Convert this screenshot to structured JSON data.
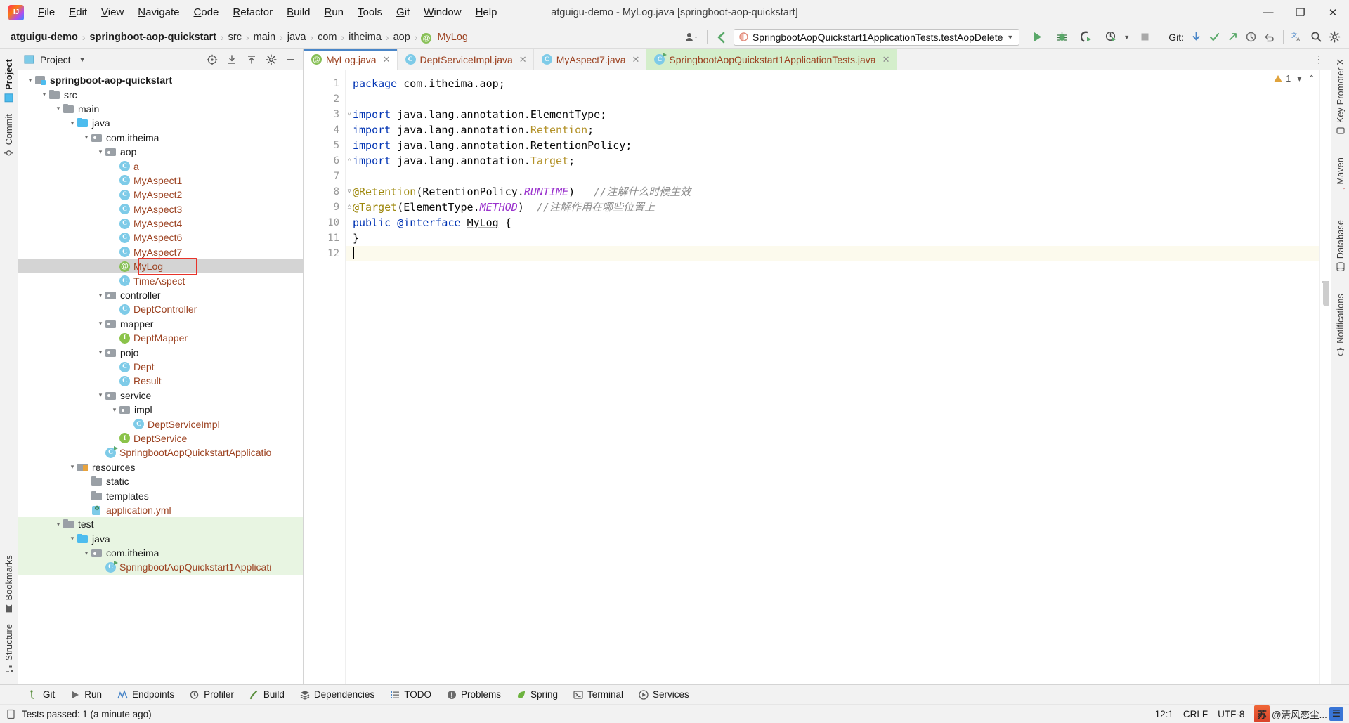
{
  "window": {
    "title": "atguigu-demo - MyLog.java [springboot-aop-quickstart]",
    "minimize": "—",
    "maximize": "❐",
    "close": "✕"
  },
  "menu": [
    {
      "label": "File"
    },
    {
      "label": "Edit"
    },
    {
      "label": "View"
    },
    {
      "label": "Navigate"
    },
    {
      "label": "Code"
    },
    {
      "label": "Refactor"
    },
    {
      "label": "Build"
    },
    {
      "label": "Run"
    },
    {
      "label": "Tools"
    },
    {
      "label": "Git"
    },
    {
      "label": "Window"
    },
    {
      "label": "Help"
    }
  ],
  "breadcrumb": {
    "items": [
      {
        "label": "atguigu-demo",
        "style": "bold"
      },
      {
        "label": "springboot-aop-quickstart",
        "style": "bold"
      },
      {
        "label": "src",
        "style": "dim"
      },
      {
        "label": "main",
        "style": "dim"
      },
      {
        "label": "java",
        "style": "dim"
      },
      {
        "label": "com",
        "style": "dim"
      },
      {
        "label": "itheima",
        "style": "dim"
      },
      {
        "label": "aop",
        "style": "dim"
      },
      {
        "label": "MyLog",
        "style": "file"
      }
    ],
    "separator": "›"
  },
  "toolbar": {
    "profile_icon": "user-profile-icon",
    "back_icon": "navigate-back-icon",
    "run_config": "SpringbootAopQuickstart1ApplicationTests.testAopDelete",
    "run_config_caret": "▼",
    "run_label": "run-button",
    "debug_label": "debug-button",
    "coverage_label": "run-with-coverage-button",
    "profile_label": "profiler-button",
    "stop_label": "stop-button",
    "git_label": "Git:",
    "git_update": "update-project-icon",
    "git_commit": "commit-icon",
    "git_push": "push-icon",
    "history_icon": "history-icon",
    "undo_icon": "undo-icon",
    "translate_icon": "translate-icon",
    "search_icon": "search-everywhere-icon",
    "settings_icon": "settings-icon",
    "more_icon": "more-options-icon"
  },
  "left_strip": [
    {
      "label": "Project",
      "active": true,
      "name": "tool-window-project"
    },
    {
      "label": "Commit",
      "active": false,
      "name": "tool-window-commit"
    },
    {
      "label": "Bookmarks",
      "active": false,
      "name": "tool-window-bookmarks"
    },
    {
      "label": "Structure",
      "active": false,
      "name": "tool-window-structure"
    }
  ],
  "right_strip": [
    {
      "label": "Key Promoter X",
      "name": "tool-window-key-promoter-x"
    },
    {
      "label": "Maven",
      "name": "tool-window-maven"
    },
    {
      "label": "Database",
      "name": "tool-window-database"
    },
    {
      "label": "Notifications",
      "name": "tool-window-notifications"
    }
  ],
  "project_panel": {
    "title": "Project",
    "title_caret": "▼",
    "actions": [
      {
        "name": "select-opened-file-icon"
      },
      {
        "name": "expand-all-icon"
      },
      {
        "name": "collapse-all-icon"
      },
      {
        "name": "settings-icon"
      },
      {
        "name": "hide-icon"
      }
    ],
    "tree": [
      {
        "label": "springboot-aop-quickstart",
        "depth": 1,
        "icon": "module",
        "chev": "down",
        "style": "bold"
      },
      {
        "label": "src",
        "depth": 2,
        "icon": "folder",
        "chev": "down"
      },
      {
        "label": "main",
        "depth": 3,
        "icon": "folder",
        "chev": "down"
      },
      {
        "label": "java",
        "depth": 4,
        "icon": "folder-blue",
        "chev": "down"
      },
      {
        "label": "com.itheima",
        "depth": 5,
        "icon": "package",
        "chev": "down"
      },
      {
        "label": "aop",
        "depth": 6,
        "icon": "package",
        "chev": "down"
      },
      {
        "label": "a",
        "depth": 7,
        "icon": "class",
        "chev": "none",
        "style": "cls"
      },
      {
        "label": "MyAspect1",
        "depth": 7,
        "icon": "class",
        "chev": "none",
        "style": "cls"
      },
      {
        "label": "MyAspect2",
        "depth": 7,
        "icon": "class",
        "chev": "none",
        "style": "cls"
      },
      {
        "label": "MyAspect3",
        "depth": 7,
        "icon": "class",
        "chev": "none",
        "style": "cls"
      },
      {
        "label": "MyAspect4",
        "depth": 7,
        "icon": "class",
        "chev": "none",
        "style": "cls"
      },
      {
        "label": "MyAspect6",
        "depth": 7,
        "icon": "class",
        "chev": "none",
        "style": "cls"
      },
      {
        "label": "MyAspect7",
        "depth": 7,
        "icon": "class",
        "chev": "none",
        "style": "cls"
      },
      {
        "label": "MyLog",
        "depth": 7,
        "icon": "annotation",
        "chev": "none",
        "style": "cls",
        "selected": true,
        "highlight_box": true
      },
      {
        "label": "TimeAspect",
        "depth": 7,
        "icon": "class",
        "chev": "none",
        "style": "cls"
      },
      {
        "label": "controller",
        "depth": 6,
        "icon": "package",
        "chev": "down"
      },
      {
        "label": "DeptController",
        "depth": 7,
        "icon": "class",
        "chev": "none",
        "style": "cls"
      },
      {
        "label": "mapper",
        "depth": 6,
        "icon": "package",
        "chev": "down"
      },
      {
        "label": "DeptMapper",
        "depth": 7,
        "icon": "interface",
        "chev": "none",
        "style": "cls"
      },
      {
        "label": "pojo",
        "depth": 6,
        "icon": "package",
        "chev": "down"
      },
      {
        "label": "Dept",
        "depth": 7,
        "icon": "class",
        "chev": "none",
        "style": "cls"
      },
      {
        "label": "Result",
        "depth": 7,
        "icon": "class",
        "chev": "none",
        "style": "cls"
      },
      {
        "label": "service",
        "depth": 6,
        "icon": "package",
        "chev": "down"
      },
      {
        "label": "impl",
        "depth": 7,
        "icon": "package",
        "chev": "down"
      },
      {
        "label": "DeptServiceImpl",
        "depth": 8,
        "icon": "class",
        "chev": "none",
        "style": "cls"
      },
      {
        "label": "DeptService",
        "depth": 7,
        "icon": "interface",
        "chev": "none",
        "style": "cls"
      },
      {
        "label": "SpringbootAopQuickstartApplicatio",
        "depth": 6,
        "icon": "runnable-class",
        "chev": "none",
        "style": "cls"
      },
      {
        "label": "resources",
        "depth": 4,
        "icon": "resources",
        "chev": "down"
      },
      {
        "label": "static",
        "depth": 5,
        "icon": "folder",
        "chev": "none"
      },
      {
        "label": "templates",
        "depth": 5,
        "icon": "folder",
        "chev": "none"
      },
      {
        "label": "application.yml",
        "depth": 5,
        "icon": "yml",
        "chev": "none",
        "style": "yml"
      },
      {
        "label": "test",
        "depth": 3,
        "icon": "folder",
        "chev": "down",
        "testbg": true
      },
      {
        "label": "java",
        "depth": 4,
        "icon": "folder-blue",
        "chev": "down",
        "testbg": true
      },
      {
        "label": "com.itheima",
        "depth": 5,
        "icon": "package",
        "chev": "down",
        "testbg": true
      },
      {
        "label": "SpringbootAopQuickstart1Applicati",
        "depth": 6,
        "icon": "runnable-class",
        "chev": "none",
        "style": "cls",
        "testbg": true
      }
    ]
  },
  "editor": {
    "tabs": [
      {
        "label": "MyLog.java",
        "icon": "annotation",
        "active": true,
        "close": "✕"
      },
      {
        "label": "DeptServiceImpl.java",
        "icon": "class",
        "active": false,
        "close": "✕"
      },
      {
        "label": "MyAspect7.java",
        "icon": "class",
        "active": false,
        "close": "✕"
      },
      {
        "label": "SpringbootAopQuickstart1ApplicationTests.java",
        "icon": "runnable-class",
        "active": false,
        "close": "✕",
        "highlight": true
      }
    ],
    "line_numbers": [
      "1",
      "2",
      "3",
      "4",
      "5",
      "6",
      "7",
      "8",
      "9",
      "10",
      "11",
      "12"
    ],
    "lines": [
      {
        "n": 1,
        "tokens": [
          {
            "t": "package ",
            "c": "kw"
          },
          {
            "t": "com.itheima.aop;",
            "c": "pkgtxt"
          }
        ]
      },
      {
        "n": 2,
        "tokens": []
      },
      {
        "n": 3,
        "fold": "collapse-start",
        "tokens": [
          {
            "t": "import ",
            "c": "kw"
          },
          {
            "t": "java.lang.annotation.ElementType;",
            "c": "pkgtxt"
          }
        ]
      },
      {
        "n": 4,
        "tokens": [
          {
            "t": "import ",
            "c": "kw"
          },
          {
            "t": "java.lang.annotation.",
            "c": "pkgtxt"
          },
          {
            "t": "Retention",
            "c": "type"
          },
          {
            "t": ";",
            "c": "pkgtxt"
          }
        ]
      },
      {
        "n": 5,
        "tokens": [
          {
            "t": "import ",
            "c": "kw"
          },
          {
            "t": "java.lang.annotation.RetentionPolicy;",
            "c": "pkgtxt"
          }
        ]
      },
      {
        "n": 6,
        "fold": "collapse-end",
        "tokens": [
          {
            "t": "import ",
            "c": "kw"
          },
          {
            "t": "java.lang.annotation.",
            "c": "pkgtxt"
          },
          {
            "t": "Target",
            "c": "type"
          },
          {
            "t": ";",
            "c": "pkgtxt"
          }
        ]
      },
      {
        "n": 7,
        "tokens": []
      },
      {
        "n": 8,
        "fold": "collapse-start",
        "tokens": [
          {
            "t": "@Retention",
            "c": "anno"
          },
          {
            "t": "(RetentionPolicy.",
            "c": "ident"
          },
          {
            "t": "RUNTIME",
            "c": "const"
          },
          {
            "t": ")",
            "c": "ident"
          },
          {
            "t": "   //注解什么时候生效",
            "c": "cmt"
          }
        ]
      },
      {
        "n": 9,
        "fold": "collapse-end",
        "tokens": [
          {
            "t": "@Target",
            "c": "anno"
          },
          {
            "t": "(ElementType.",
            "c": "ident"
          },
          {
            "t": "METHOD",
            "c": "const"
          },
          {
            "t": ")",
            "c": "ident"
          },
          {
            "t": "  //注解作用在哪些位置上",
            "c": "cmt"
          }
        ]
      },
      {
        "n": 10,
        "tokens": [
          {
            "t": "public ",
            "c": "kw"
          },
          {
            "t": "@interface ",
            "c": "kw"
          },
          {
            "t": "MyLog",
            "c": "annoname"
          },
          {
            "t": " {",
            "c": "ident"
          }
        ]
      },
      {
        "n": 11,
        "tokens": [
          {
            "t": "}",
            "c": "ident"
          }
        ]
      },
      {
        "n": 12,
        "cursor": true,
        "tokens": []
      }
    ],
    "inspection_count": "1",
    "inspection_caret": "▾",
    "inspection_collapse": "⌃"
  },
  "bottom_tools": [
    {
      "label": "Git",
      "icon": "git-branch-icon"
    },
    {
      "label": "Run",
      "icon": "run-icon"
    },
    {
      "label": "Endpoints",
      "icon": "endpoints-icon"
    },
    {
      "label": "Profiler",
      "icon": "profiler-icon"
    },
    {
      "label": "Build",
      "icon": "build-hammer-icon"
    },
    {
      "label": "Dependencies",
      "icon": "dependencies-icon"
    },
    {
      "label": "TODO",
      "icon": "todo-list-icon"
    },
    {
      "label": "Problems",
      "icon": "problems-icon"
    },
    {
      "label": "Spring",
      "icon": "spring-leaf-icon"
    },
    {
      "label": "Terminal",
      "icon": "terminal-icon"
    },
    {
      "label": "Services",
      "icon": "services-icon"
    }
  ],
  "status_bar": {
    "message": "Tests passed: 1 (a minute ago)",
    "message_icon": "tests-status-icon",
    "position": "12:1",
    "line_sep": "CRLF",
    "encoding": "UTF-8",
    "watermark_badge": "苏",
    "watermark_text": "@清风恋尘...",
    "watermark_blue": "☰"
  },
  "colors": {
    "accent_blue": "#4a86c8",
    "selection_gray": "#d4d4d4",
    "highlight_red": "#e8332a",
    "class_name": "#9c4221",
    "test_green": "#e8f5e2",
    "keyword_blue": "#0033b3",
    "annotation_gold": "#9e880d",
    "constant_purple": "#9a32cd",
    "comment_gray": "#8c8c8c"
  }
}
